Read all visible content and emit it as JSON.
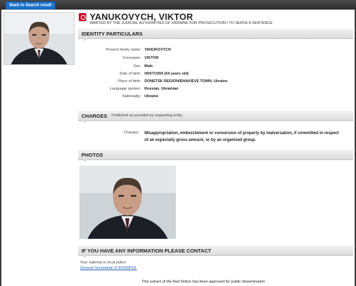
{
  "nav": {
    "back_label": "Back to Search result"
  },
  "header": {
    "name": "YANUKOVYCH, VIKTOR",
    "subtitle": "WANTED BY THE JUDICIAL AUTHORITIES OF UKRAINE FOR PROSECUTION / TO SERVE A SENTENCE"
  },
  "identity": {
    "title": "IDENTITY PARTICULARS",
    "rows": [
      {
        "label": "Present family name:",
        "value": "YANUKOVYCH"
      },
      {
        "label": "Forename:",
        "value": "VIKTOR"
      },
      {
        "label": "Sex:",
        "value": "Male"
      },
      {
        "label": "Date of birth:",
        "value": "09/07/1950 (64 years old)"
      },
      {
        "label": "Place of birth:",
        "value": "DONETSK REGION/ENAKIEVE TOWN, Ukraine"
      },
      {
        "label": "Language spoken:",
        "value": "Russian, Ukrainian"
      },
      {
        "label": "Nationality:",
        "value": "Ukraine"
      }
    ]
  },
  "charges": {
    "title": "CHARGES",
    "note": "Published as provided by requesting entity",
    "label": "Charges:",
    "text": "Misappropriation, embezzlement or conversion of property by malversation, if committed in respect of an especially gross amount, or by an organized group."
  },
  "photos": {
    "title": "PHOTOS"
  },
  "contact": {
    "title": "IF YOU HAVE ANY INFORMATION PLEASE CONTACT",
    "line1": "Your national or local police",
    "link": "General Secretariat of INTERPOL"
  },
  "footer": {
    "text": "This extract of the Red Notice has been approved for public dissemination"
  },
  "colors": {
    "accent": "#c8102e",
    "link": "#1b5fb0",
    "button": "#1b73c9"
  },
  "icons": {
    "emblem": "red-notice-emblem-icon"
  }
}
